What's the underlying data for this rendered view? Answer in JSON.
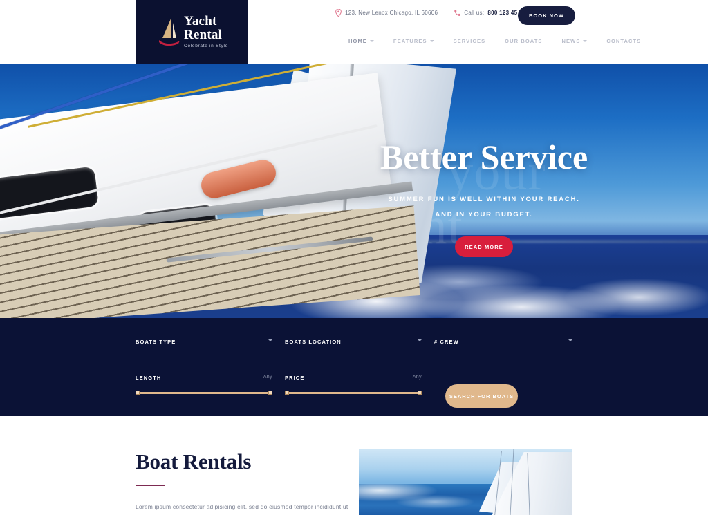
{
  "brand": {
    "line1": "Yacht",
    "line2": "Rental",
    "tagline": "Celebrate in Style",
    "icon": "sailboat-logo-icon",
    "sail_color": "#d6b483",
    "hull_color": "#c2203f",
    "block_bg": "#0b1130"
  },
  "topbar": {
    "address": "123, New Lenox Chicago, IL 60606",
    "pin_icon": "map-pin-icon",
    "phone_icon": "phone-icon",
    "call_prefix": "Call us:",
    "phone": "800 123 45 67",
    "book_now_label": "BOOK NOW",
    "book_now_bg": "#171d3f"
  },
  "nav": {
    "items": [
      {
        "label": "HOME",
        "has_dropdown": true,
        "active": true
      },
      {
        "label": "FEATURES",
        "has_dropdown": true,
        "active": false
      },
      {
        "label": "SERVICES",
        "has_dropdown": false,
        "active": false
      },
      {
        "label": "OUR BOATS",
        "has_dropdown": false,
        "active": false
      },
      {
        "label": "NEWS",
        "has_dropdown": true,
        "active": false
      },
      {
        "label": "CONTACTS",
        "has_dropdown": false,
        "active": false
      }
    ],
    "caret_icon": "chevron-down-icon"
  },
  "hero": {
    "watermark": "find your yacht",
    "heading": "Better Service",
    "sub_line1": "SUMMER FUN IS WELL WITHIN YOUR REACH.",
    "sub_line2": "AND IN YOUR BUDGET.",
    "cta_label": "READ MORE",
    "cta_bg": "#d81e3c",
    "image_alt": "sailing-yacht-deck-photo"
  },
  "search": {
    "bg": "#0b1236",
    "accent": "#e0b88c",
    "fields": [
      {
        "label": "BOATS TYPE",
        "type": "select",
        "value": ""
      },
      {
        "label": "BOATS LOCATION",
        "type": "select",
        "value": ""
      },
      {
        "label": "# CREW",
        "type": "select",
        "value": ""
      }
    ],
    "sliders": [
      {
        "label": "LENGTH",
        "value": "Any"
      },
      {
        "label": "PRICE",
        "value": "Any"
      }
    ],
    "button_label": "SEARCH FOR BOATS"
  },
  "rentals": {
    "heading": "Boat Rentals",
    "divider_color": "#7d2b52",
    "paragraph": "Lorem ipsum consectetur adipisicing elit, sed do eiusmod tempor incididunt ut",
    "image_alt": "ocean-horizon-with-sails-photo"
  }
}
